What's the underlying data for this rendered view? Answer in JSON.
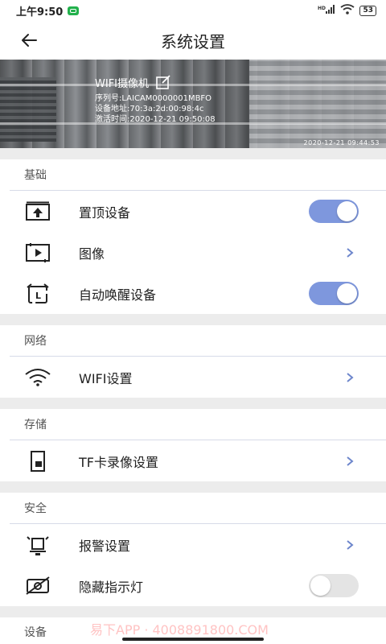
{
  "status_bar": {
    "time": "上午9:50",
    "signal": "HD",
    "battery": "53"
  },
  "header": {
    "title": "系统设置"
  },
  "camera": {
    "name": "WIFI摄像机",
    "serial": "序列号:LAICAM0000001MBFO",
    "mac": "设备地址:70:3a:2d:00:98:4c",
    "activated": "激活时间:2020-12-21 09:50:08",
    "osd": "2020-12-21 09:44:53"
  },
  "sections": {
    "basic": {
      "title": "基础",
      "pin": {
        "label": "置顶设备",
        "on": true
      },
      "image": {
        "label": "图像"
      },
      "auto_wake": {
        "label": "自动唤醒设备",
        "on": true
      }
    },
    "network": {
      "title": "网络",
      "wifi": {
        "label": "WIFI设置"
      }
    },
    "storage": {
      "title": "存储",
      "tf": {
        "label": "TF卡录像设置"
      }
    },
    "security": {
      "title": "安全",
      "alarm": {
        "label": "报警设置"
      },
      "hide_led": {
        "label": "隐藏指示灯",
        "on": false
      }
    },
    "device": {
      "title": "设备"
    }
  },
  "watermark": "易下APP · 4008891800.COM",
  "colors": {
    "toggle_on": "#7e97dd",
    "toggle_off": "#e4e4e4",
    "divider": "#d7dbe8"
  }
}
